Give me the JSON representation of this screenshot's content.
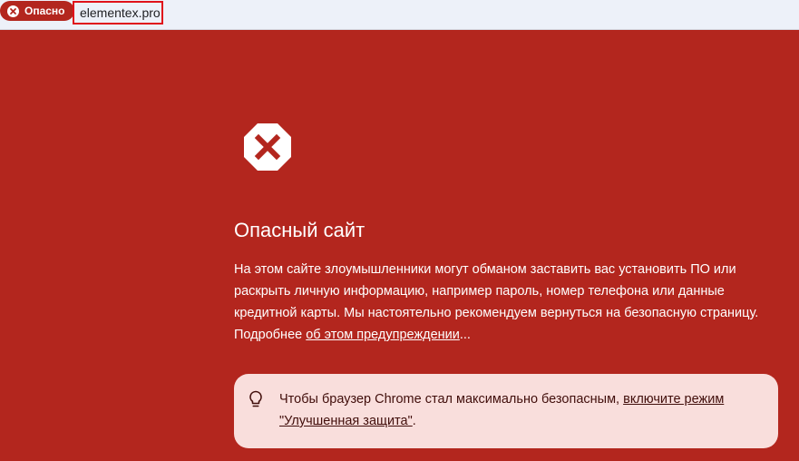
{
  "address_bar": {
    "security_chip_label": "Опасно",
    "security_chip_icon": "close-circle-icon",
    "url": "elementex.pro"
  },
  "interstitial": {
    "icon": "blocked-octagon-icon",
    "title": "Опасный сайт",
    "description_part1": "На этом сайте злоумышленники могут обманом заставить вас установить ПО или раскрыть личную информацию, например пароль, номер телефона или данные кредитной карты. Мы настоятельно рекомендуем вернуться на безопасную страницу. Подробнее ",
    "details_link": "об этом предупреждении",
    "details_suffix": "...",
    "tip_icon": "lightbulb-icon",
    "tip_text": "Чтобы браузер Chrome стал максимально безопасным, ",
    "tip_link": "включите режим \"Улучшенная защита\"",
    "tip_suffix": "."
  },
  "colors": {
    "danger_background": "#b3261e",
    "tip_background": "#f9dedc",
    "url_highlight_border": "#e0121b"
  }
}
